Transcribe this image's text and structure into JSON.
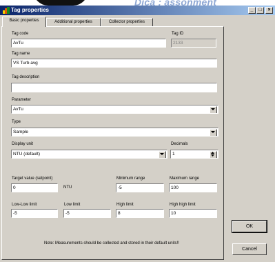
{
  "banner": {
    "text": "Dica : assonment"
  },
  "window": {
    "title": "Tag properties",
    "minimize": "_",
    "maximize": "□",
    "close": "×"
  },
  "tabs": [
    "Basic properties",
    "Additional properties",
    "Collector properties"
  ],
  "form": {
    "tag_code": {
      "label": "Tag code",
      "value": "AvTu"
    },
    "tag_id": {
      "label": "Tag ID",
      "value": "2133"
    },
    "tag_name": {
      "label": "Tag name",
      "value": "VS Turb avg"
    },
    "tag_description": {
      "label": "Tag description",
      "value": ""
    },
    "parameter": {
      "label": "Parameter",
      "value": "AvTu"
    },
    "type": {
      "label": "Type",
      "value": "Sample"
    },
    "display_unit": {
      "label": "Display unit",
      "value": "NTU (default)"
    },
    "decimals": {
      "label": "Decimals",
      "value": "1"
    },
    "target_value": {
      "label": "Target value (setpoint)",
      "value": "0",
      "unit": "NTU"
    },
    "minimum_range": {
      "label": "Minimum range",
      "value": "-5"
    },
    "maximum_range": {
      "label": "Maximum range",
      "value": "100"
    },
    "low_low_limit": {
      "label": "Low-Low limit",
      "value": "-5"
    },
    "low_limit": {
      "label": "Low limit",
      "value": "-5"
    },
    "high_limit": {
      "label": "High limit",
      "value": "8"
    },
    "high_high_limit": {
      "label": "High high limit",
      "value": "10"
    },
    "note": "Note: Measurements should be collected and stored in their default units!!"
  },
  "buttons": {
    "ok": "OK",
    "cancel": "Cancel"
  }
}
